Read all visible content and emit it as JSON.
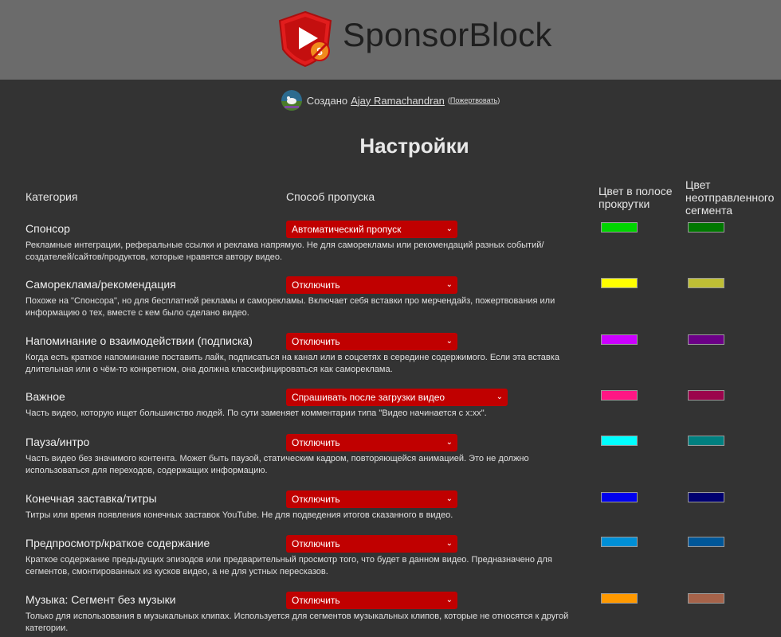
{
  "brand": {
    "name": "SponsorBlock"
  },
  "credit": {
    "prefix": "Создано",
    "author": "Ajay Ramachandran",
    "donate": "Пожертвовать"
  },
  "title": "Настройки",
  "columns": {
    "category": "Категория",
    "skip_method": "Способ пропуска",
    "bar_color": "Цвет в полосе прокрутки",
    "unsubmitted_color": "Цвет неотправленного сегмента"
  },
  "categories": [
    {
      "name": "Спонсор",
      "description": "Рекламные интеграции, реферальные ссылки и реклама напрямую. Не для саморекламы или рекомендаций разных событий/создателей/сайтов/продуктов, которые нравятся автору видео.",
      "option": "Автоматический пропуск",
      "color": "#00d400",
      "preview_color": "#007800"
    },
    {
      "name": "Самореклама/рекомендация",
      "description": "Похоже на \"Спонсора\", но для бесплатной рекламы и саморекламы. Включает себя вставки про мерчендайз, пожертвования или информацию о тех, вместе с кем было сделано видео.",
      "option": "Отключить",
      "color": "#ffff00",
      "preview_color": "#bfbf35"
    },
    {
      "name": "Напоминание о взаимодействии (подписка)",
      "description": "Когда есть краткое напоминание поставить лайк, подписаться на канал или в соцсетях в середине содержимого. Если эта вставка длительная или о чём-то конкретном, она должна классифицироваться как самореклама.",
      "option": "Отключить",
      "color": "#cc00ff",
      "preview_color": "#6c0087"
    },
    {
      "name": "Важное",
      "description": "Часть видео, которую ищет большинство людей. По сути заменяет комментарии типа \"Видео начинается с x:xx\".",
      "option": "Спрашивать после загрузки видео",
      "color": "#ff1684",
      "preview_color": "#9b044c"
    },
    {
      "name": "Пауза/интро",
      "description": "Часть видео без значимого контента. Может быть паузой, статическим кадром, повторяющейся анимацией. Это не должно использоваться для переходов, содержащих информацию.",
      "option": "Отключить",
      "color": "#00ffff",
      "preview_color": "#008080"
    },
    {
      "name": "Конечная заставка/титры",
      "description": "Титры или время появления конечных заставок YouTube. Не для подведения итогов сказанного в видео.",
      "option": "Отключить",
      "color": "#0202ed",
      "preview_color": "#000070"
    },
    {
      "name": "Предпросмотр/краткое содержание",
      "description": "Краткое содержание предыдущих эпизодов или предварительный просмотр того, что будет в данном видео. Предназначено для сегментов, смонтированных из кусков видео, а не для устных пересказов.",
      "option": "Отключить",
      "color": "#008fd6",
      "preview_color": "#005799"
    },
    {
      "name": "Музыка: Сегмент без музыки",
      "description": "Только для использования в музыкальных клипах. Используется для сегментов музыкальных клипов, которые не относятся к другой категории.",
      "option": "Отключить",
      "color": "#ff9900",
      "preview_color": "#a6634a"
    }
  ]
}
